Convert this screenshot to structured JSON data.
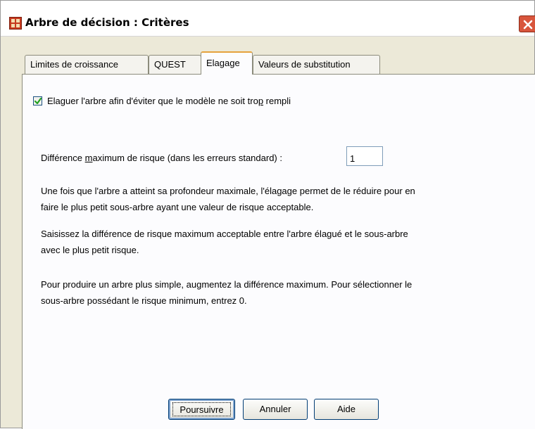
{
  "window": {
    "title": "Arbre de décision : Critères"
  },
  "tabs": [
    {
      "label": "Limites de croissance",
      "active": false
    },
    {
      "label": "QUEST",
      "active": false
    },
    {
      "label": "Elagage",
      "active": true
    },
    {
      "label": "Valeurs de substitution",
      "active": false
    }
  ],
  "pruning": {
    "checkbox_checked": true,
    "checkbox_label_before": "Elaguer l'arbre afin d'éviter que le modèle ne soit tro",
    "checkbox_label_mnemonic": "p",
    "checkbox_label_after": " rempli",
    "risk_label_before": "Différence ",
    "risk_label_mnemonic": "m",
    "risk_label_after": "aximum de risque (dans les erreurs standard) :",
    "risk_value": "1",
    "para1_line1": "Une fois que l'arbre a atteint sa profondeur maximale, l'élagage permet de le réduire pour en",
    "para1_line2": "faire le plus petit sous-arbre ayant une valeur de risque acceptable.",
    "para2_line1": "Saisissez la différence de risque maximum acceptable entre l'arbre élagué et le sous-arbre",
    "para2_line2": "avec le plus petit risque.",
    "para3_line1": "Pour produire un arbre plus simple, augmentez la différence maximum. Pour sélectionner le",
    "para3_line2": "sous-arbre possédant le risque minimum, entrez 0."
  },
  "buttons": {
    "continue_label": "Poursuivre",
    "cancel_label": "Annuler",
    "help_label": "Aide"
  },
  "colors": {
    "dialog_background": "#ece9d8",
    "active_tab_accent": "#e6a23c",
    "close_button": "#d8553c",
    "checkmark": "#21a121"
  },
  "icons": {
    "app": "spss-table-icon",
    "close": "close-icon",
    "check": "checkmark-icon"
  }
}
